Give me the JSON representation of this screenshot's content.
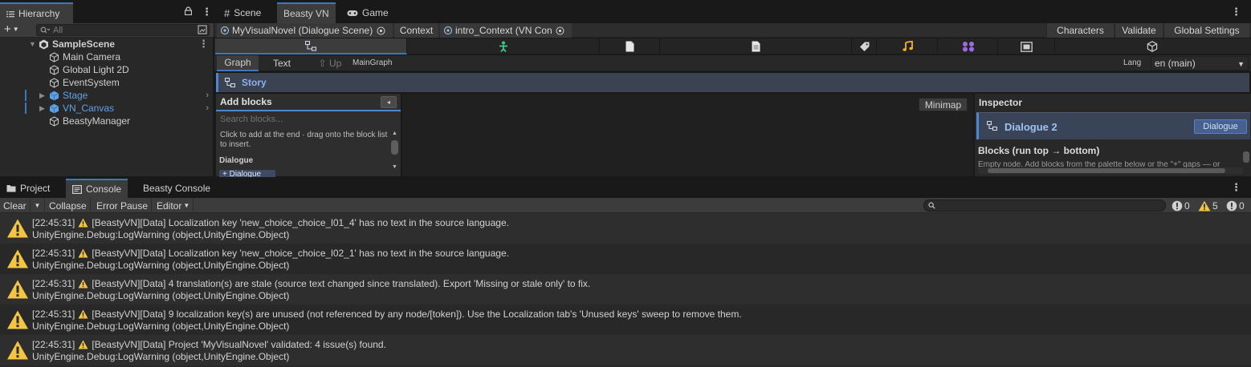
{
  "hierarchy": {
    "tab_label": "Hierarchy",
    "search_placeholder": "All",
    "add_label": "+",
    "items": [
      {
        "label": "SampleScene",
        "icon": "unity-scene-icon",
        "selected_style": "bold"
      },
      {
        "label": "Main Camera",
        "icon": "gameobject-icon"
      },
      {
        "label": "Global Light 2D",
        "icon": "gameobject-icon"
      },
      {
        "label": "EventSystem",
        "icon": "gameobject-icon"
      },
      {
        "label": "Stage",
        "icon": "prefab-icon",
        "color": "#5ea2e6"
      },
      {
        "label": "VN_Canvas",
        "icon": "prefab-icon",
        "color": "#5ea2e6"
      },
      {
        "label": "BeastyManager",
        "icon": "gameobject-icon"
      }
    ]
  },
  "top_tabs": {
    "scene": "Scene",
    "beasty": "Beasty VN",
    "game": "Game"
  },
  "context_bar": {
    "tab1": "MyVisualNovel (Dialogue Scene)",
    "tab2": "Context",
    "tab3": "intro_Context (VN Con",
    "characters": "Characters",
    "validate": "Validate",
    "global_settings": "Global Settings"
  },
  "icon_bar": [
    "graph-icon",
    "character-icon",
    "page-icon",
    "document-icon",
    "tag-icon",
    "music-icon",
    "nodes-icon",
    "frame-icon",
    "cube-icon"
  ],
  "mode_bar": {
    "graph": "Graph",
    "text": "Text",
    "up": "⇧ Up",
    "graph_name": "MainGraph",
    "lang_label": "Lang",
    "lang_value": "en (main)"
  },
  "story_bar": {
    "label": "Story"
  },
  "add_blocks": {
    "title": "Add blocks",
    "collapse": "◂",
    "search_placeholder": "Search blocks...",
    "hint": "Click to add at the end · drag onto the block list to insert.",
    "category": "Dialogue",
    "first_item": "+ Dialogue"
  },
  "canvas": {
    "minimap": "Minimap"
  },
  "inspector": {
    "title": "Inspector",
    "node_name": "Dialogue 2",
    "node_type": "Dialogue",
    "blocks_title": "Blocks (run top → bottom)",
    "empty_text": "Empty node. Add blocks from the palette below or the \"+\" gaps — or"
  },
  "console": {
    "tabs": {
      "project": "Project",
      "console": "Console",
      "beasty": "Beasty Console"
    },
    "toolbar": {
      "clear": "Clear",
      "collapse": "Collapse",
      "error_pause": "Error Pause",
      "editor": "Editor"
    },
    "counts": {
      "errors": "0",
      "warnings": "5",
      "messages": "0"
    },
    "colors": {
      "warning": "#f4c542",
      "accent": "#3a79bb"
    },
    "logs": [
      {
        "time": "[22:45:31]",
        "message": "[BeastyVN][Data] Localization key 'new_choice_choice_l01_4' has no text in the source language.",
        "stack": "UnityEngine.Debug:LogWarning (object,UnityEngine.Object)"
      },
      {
        "time": "[22:45:31]",
        "message": "[BeastyVN][Data] Localization key 'new_choice_choice_l02_1' has no text in the source language.",
        "stack": "UnityEngine.Debug:LogWarning (object,UnityEngine.Object)"
      },
      {
        "time": "[22:45:31]",
        "message": "[BeastyVN][Data] 4 translation(s) are stale (source text changed since translated). Export 'Missing or stale only' to fix.",
        "stack": "UnityEngine.Debug:LogWarning (object,UnityEngine.Object)"
      },
      {
        "time": "[22:45:31]",
        "message": "[BeastyVN][Data] 9 localization key(s) are unused (not referenced by any node/[token]). Use the Localization tab's 'Unused keys' sweep to remove them.",
        "stack": "UnityEngine.Debug:LogWarning (object,UnityEngine.Object)"
      },
      {
        "time": "[22:45:31]",
        "message": "[BeastyVN][Data] Project 'MyVisualNovel' validated: 4 issue(s) found.",
        "stack": "UnityEngine.Debug:LogWarning (object,UnityEngine.Object)"
      }
    ]
  }
}
